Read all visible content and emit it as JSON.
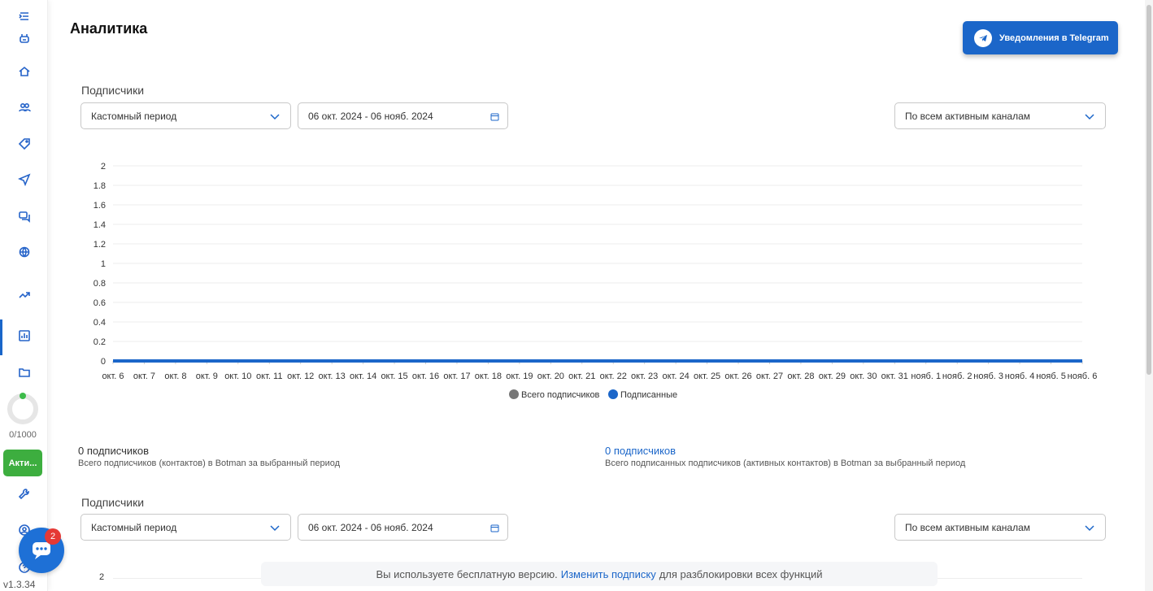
{
  "sidebar": {
    "items": [
      {
        "icon": "menu-collapse-icon"
      },
      {
        "icon": "bot-icon"
      },
      {
        "icon": "home-icon"
      },
      {
        "icon": "users-icon"
      },
      {
        "icon": "tag-icon"
      },
      {
        "icon": "send-icon"
      },
      {
        "icon": "chat-icon"
      },
      {
        "icon": "globe-icon"
      },
      {
        "icon": "trending-icon"
      },
      {
        "icon": "bar-chart-icon",
        "active": true
      },
      {
        "icon": "folder-icon"
      },
      {
        "icon": "wrench-icon"
      },
      {
        "icon": "user-icon"
      },
      {
        "icon": "help-icon"
      }
    ],
    "limit_text": "0/1000",
    "limit_used": 0,
    "plan_button": "Акти...",
    "version": "v1.3.34",
    "chat_badge": "2"
  },
  "header": {
    "title": "Аналитика",
    "telegram_button": "Уведомления в Telegram"
  },
  "section1": {
    "label": "Подписчики",
    "period_select": "Кастомный период",
    "date_range": "06 окт. 2024 - 06 нояб. 2024",
    "channel_select": "По всем активным каналам"
  },
  "stats": {
    "total_value": "0 подписчиков",
    "total_desc": "Всего подписчиков (контактов) в Botman за выбранный период",
    "active_value": "0 подписчиков",
    "active_desc": "Всего подписанных подписчиков (активных контактов) в Botman за выбранный период"
  },
  "section2": {
    "label": "Подписчики",
    "period_select": "Кастомный период",
    "date_range": "06 окт. 2024 - 06 нояб. 2024",
    "channel_select": "По всем активным каналам",
    "y_top_tick": "2"
  },
  "banner": {
    "prefix": "Вы используете бесплатную версию.",
    "link": "Изменить подписку",
    "suffix": "для разблокировки всех функций"
  },
  "colors": {
    "accent": "#1b66c9",
    "series_total": "#777777",
    "series_subscribed": "#1b66c9",
    "plan_green": "#3dae3f"
  },
  "chart_data": {
    "type": "line",
    "title": "",
    "categories": [
      "окт. 6",
      "окт. 7",
      "окт. 8",
      "окт. 9",
      "окт. 10",
      "окт. 11",
      "окт. 12",
      "окт. 13",
      "окт. 14",
      "окт. 15",
      "окт. 16",
      "окт. 17",
      "окт. 18",
      "окт. 19",
      "окт. 20",
      "окт. 21",
      "окт. 22",
      "окт. 23",
      "окт. 24",
      "окт. 25",
      "окт. 26",
      "окт. 27",
      "окт. 28",
      "окт. 29",
      "окт. 30",
      "окт. 31",
      "нояб. 1",
      "нояб. 2",
      "нояб. 3",
      "нояб. 4",
      "нояб. 5",
      "нояб. 6"
    ],
    "series": [
      {
        "name": "Всего подписчиков",
        "values": [
          0,
          0,
          0,
          0,
          0,
          0,
          0,
          0,
          0,
          0,
          0,
          0,
          0,
          0,
          0,
          0,
          0,
          0,
          0,
          0,
          0,
          0,
          0,
          0,
          0,
          0,
          0,
          0,
          0,
          0,
          0,
          0
        ]
      },
      {
        "name": "Подписанные",
        "values": [
          0,
          0,
          0,
          0,
          0,
          0,
          0,
          0,
          0,
          0,
          0,
          0,
          0,
          0,
          0,
          0,
          0,
          0,
          0,
          0,
          0,
          0,
          0,
          0,
          0,
          0,
          0,
          0,
          0,
          0,
          0,
          0
        ]
      }
    ],
    "yticks": [
      "0",
      "0.2",
      "0.4",
      "0.6",
      "0.8",
      "1",
      "1.2",
      "1.4",
      "1.6",
      "1.8",
      "2"
    ],
    "ylim": [
      0,
      2
    ],
    "grid": true,
    "legend": "bottom-center"
  }
}
